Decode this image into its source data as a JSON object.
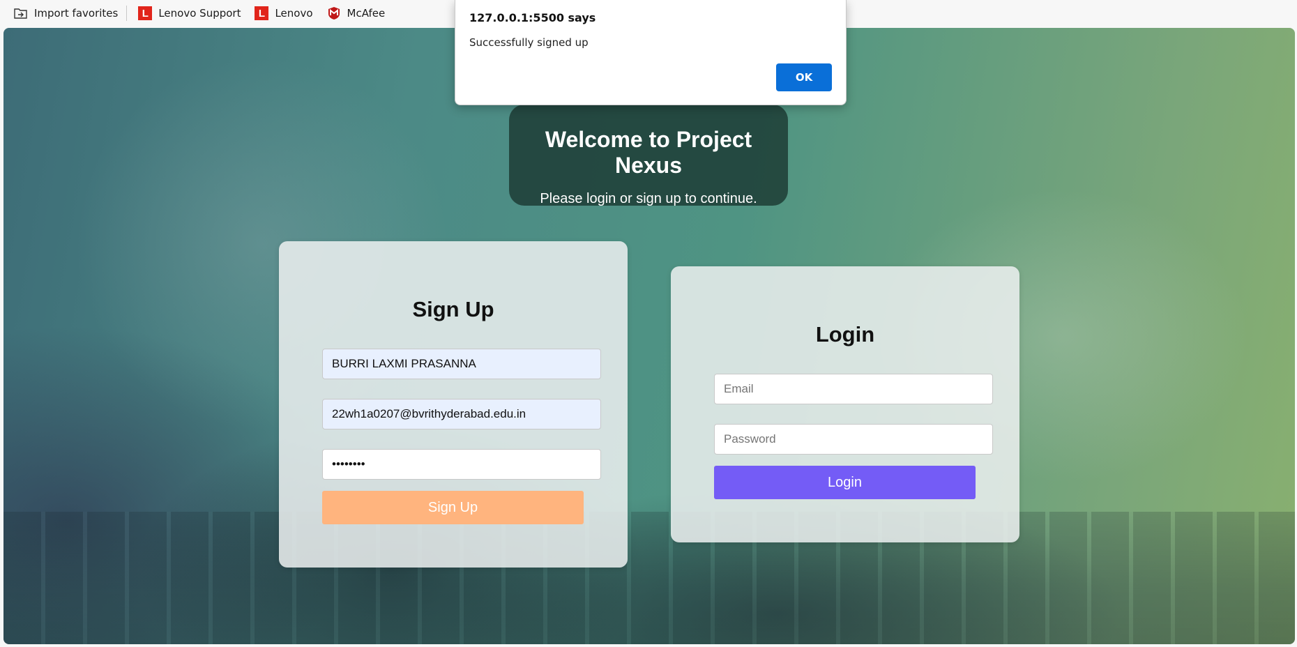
{
  "favorites_bar": {
    "items": [
      {
        "label": "Import favorites",
        "icon": "import-favorites-icon"
      },
      {
        "label": "Lenovo Support",
        "icon": "lenovo-icon",
        "icon_letter": "L"
      },
      {
        "label": "Lenovo",
        "icon": "lenovo-icon",
        "icon_letter": "L"
      },
      {
        "label": "McAfee",
        "icon": "mcafee-icon"
      }
    ]
  },
  "alert": {
    "origin": "127.0.0.1:5500 says",
    "message": "Successfully signed up",
    "ok_label": "OK",
    "ok_color": "#0a6fd8"
  },
  "welcome": {
    "title": "Welcome to Project Nexus",
    "subtitle": "Please login or sign up to continue."
  },
  "signup": {
    "heading": "Sign Up",
    "name_value": "BURRI LAXMI PRASANNA",
    "email_value": "22wh1a0207@bvrithyderabad.edu.in",
    "password_masked": "••••••••",
    "button_label": "Sign Up",
    "button_color": "#ffb47e"
  },
  "login": {
    "heading": "Login",
    "email_placeholder": "Email",
    "password_placeholder": "Password",
    "button_label": "Login",
    "button_color": "#745cf6"
  }
}
